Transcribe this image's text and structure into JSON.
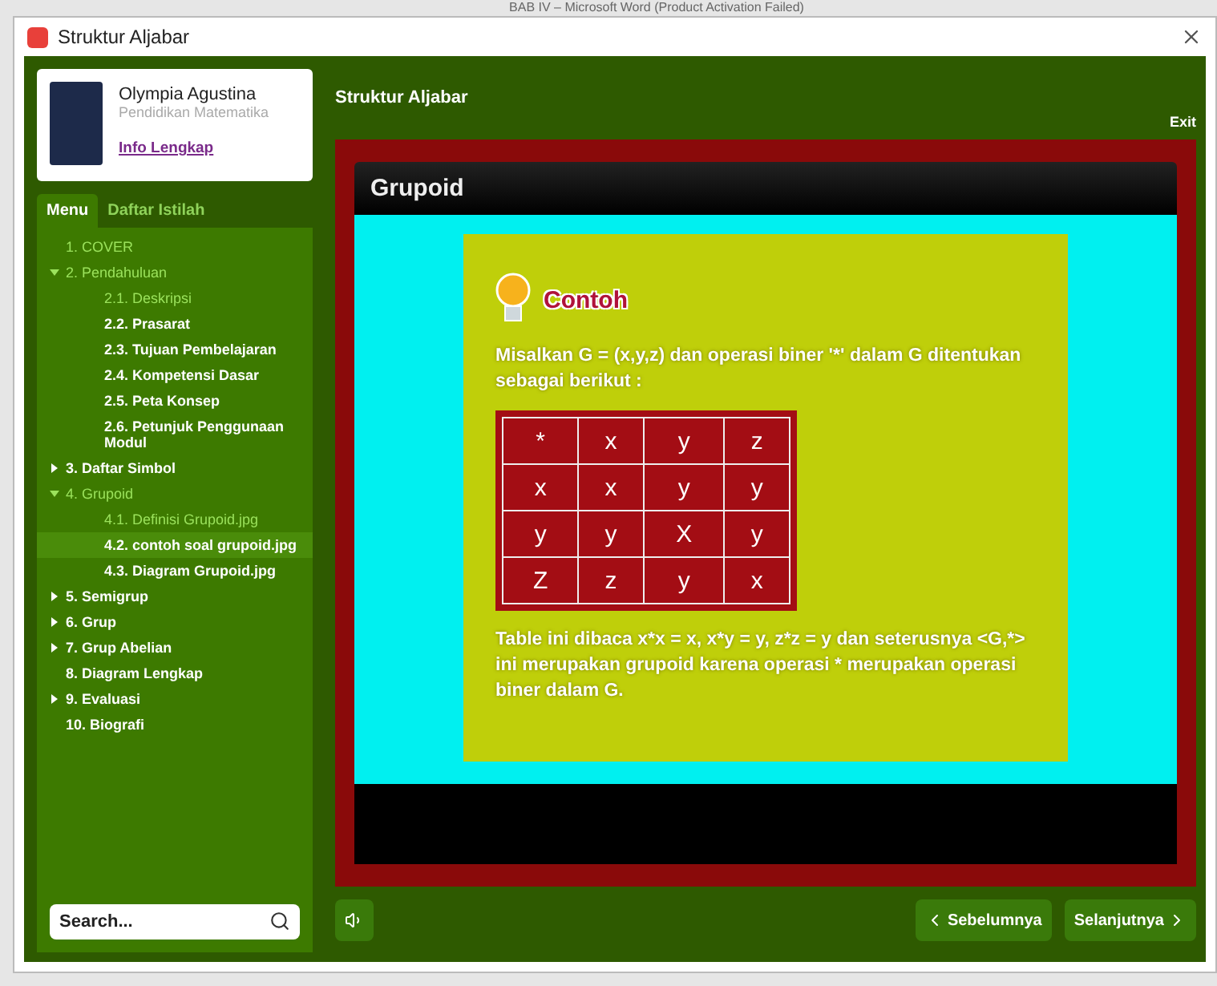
{
  "background_title": "BAB IV – Microsoft Word (Product Activation Failed)",
  "window": {
    "title": "Struktur Aljabar"
  },
  "profile": {
    "name": "Olympia Agustina",
    "subtitle": "Pendidikan Matematika",
    "link": "Info Lengkap"
  },
  "tabs": [
    {
      "label": "Menu",
      "selected": true
    },
    {
      "label": "Daftar Istilah",
      "selected": false
    }
  ],
  "menu": [
    {
      "label": "1. COVER",
      "visited": true,
      "selected": false
    },
    {
      "label": "2. Pendahuluan",
      "visited": true,
      "selected": false,
      "expanded": true,
      "children": [
        {
          "label": "2.1. Deskripsi",
          "visited": true,
          "selected": false
        },
        {
          "label": "2.2. Prasarat",
          "visited": false,
          "selected": false
        },
        {
          "label": "2.3. Tujuan Pembelajaran",
          "visited": false,
          "selected": false
        },
        {
          "label": "2.4. Kompetensi Dasar",
          "visited": false,
          "selected": false
        },
        {
          "label": "2.5. Peta Konsep",
          "visited": false,
          "selected": false
        },
        {
          "label": "2.6. Petunjuk Penggunaan Modul",
          "visited": false,
          "selected": false
        }
      ]
    },
    {
      "label": "3. Daftar Simbol",
      "visited": false,
      "selected": false,
      "expanded": false
    },
    {
      "label": "4. Grupoid",
      "visited": true,
      "selected": false,
      "expanded": true,
      "children": [
        {
          "label": "4.1. Definisi Grupoid.jpg",
          "visited": true,
          "selected": false
        },
        {
          "label": "4.2. contoh soal grupoid.jpg",
          "visited": false,
          "selected": true
        },
        {
          "label": "4.3. Diagram Grupoid.jpg",
          "visited": false,
          "selected": false
        }
      ]
    },
    {
      "label": "5. Semigrup",
      "visited": false,
      "selected": false,
      "expanded": false
    },
    {
      "label": "6. Grup",
      "visited": false,
      "selected": false,
      "expanded": false
    },
    {
      "label": "7. Grup Abelian",
      "visited": false,
      "selected": false,
      "expanded": false
    },
    {
      "label": "8. Diagram Lengkap",
      "visited": false,
      "selected": false
    },
    {
      "label": "9. Evaluasi",
      "visited": false,
      "selected": false,
      "expanded": false
    },
    {
      "label": "10. Biografi",
      "visited": false,
      "selected": false
    }
  ],
  "search": {
    "placeholder": "Search..."
  },
  "header": {
    "title": "Struktur Aljabar",
    "exit": "Exit"
  },
  "slide": {
    "title": "Grupoid",
    "heading": "Contoh",
    "intro": "Misalkan G = (x,y,z) dan operasi biner '*' dalam G ditentukan sebagai berikut :",
    "table": [
      [
        "*",
        "x",
        "y",
        "z"
      ],
      [
        "x",
        "x",
        "y",
        "y"
      ],
      [
        "y",
        "y",
        "X",
        "y"
      ],
      [
        "Z",
        "z",
        "y",
        "x"
      ]
    ],
    "note": "Table ini dibaca x*x = x, x*y = y, z*z = y dan seterusnya <G,*> ini merupakan grupoid karena operasi * merupakan operasi biner dalam G."
  },
  "nav": {
    "previous": "Sebelumnya",
    "next": "Selanjutnya"
  }
}
